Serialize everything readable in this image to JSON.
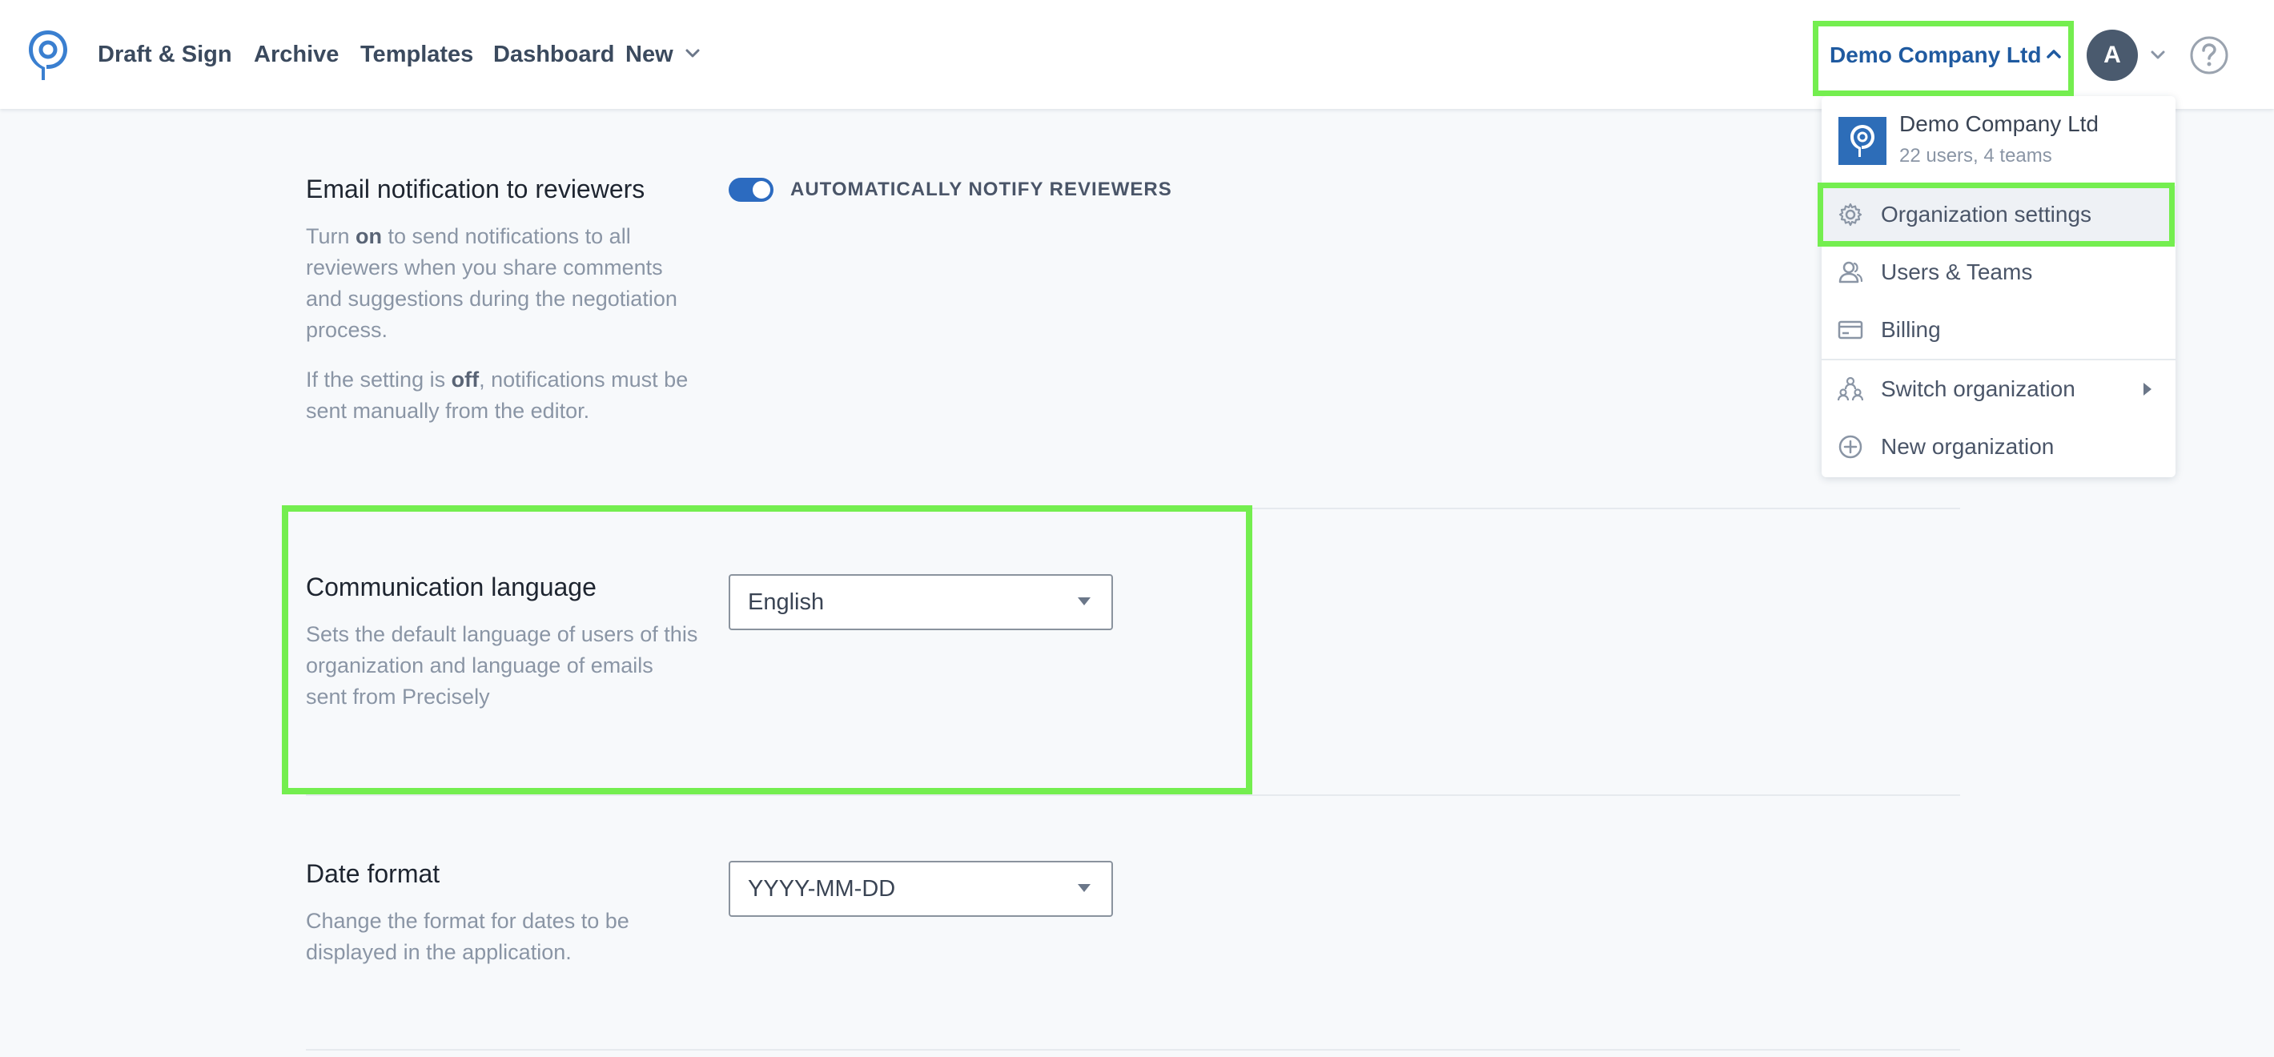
{
  "nav": {
    "items": [
      "Draft & Sign",
      "Archive",
      "Templates",
      "Dashboard",
      "New"
    ],
    "org_button": "Demo Company Ltd",
    "avatar_initial": "A"
  },
  "settings": {
    "email_notification": {
      "title": "Email notification to reviewers",
      "desc_1_pre": "Turn ",
      "desc_1_bold": "on",
      "desc_1_post": " to send notifications to all reviewers when you share comments and suggestions during the negotiation process.",
      "desc_2_pre": "If the setting is ",
      "desc_2_bold": "off",
      "desc_2_post": ", notifications must be sent manually from the editor.",
      "toggle_label": "AUTOMATICALLY NOTIFY REVIEWERS",
      "toggle_on": true
    },
    "language": {
      "title": "Communication language",
      "desc": "Sets the default language of users of this organization and language of emails sent from Precisely",
      "value": "English"
    },
    "date_format": {
      "title": "Date format",
      "desc": "Change the format for dates to be displayed in the application.",
      "value": "YYYY-MM-DD"
    }
  },
  "org_menu": {
    "org_name": "Demo Company Ltd",
    "org_meta": "22 users, 4 teams",
    "items": [
      {
        "label": "Organization settings",
        "icon": "gear-icon"
      },
      {
        "label": "Users & Teams",
        "icon": "users-icon"
      },
      {
        "label": "Billing",
        "icon": "credit-card-icon"
      },
      {
        "label": "Switch organization",
        "icon": "switch-org-icon"
      },
      {
        "label": "New organization",
        "icon": "plus-circle-icon"
      }
    ]
  },
  "colors": {
    "accent": "#2c6bc0",
    "highlight": "#74ee4f",
    "nav_text": "#3b4a5e"
  }
}
